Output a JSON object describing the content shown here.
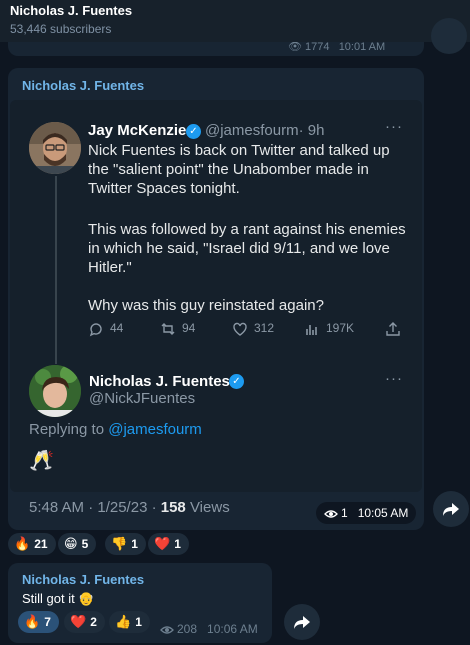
{
  "header": {
    "title": "Nicholas J. Fuentes",
    "subscribers": "53,446 subscribers"
  },
  "previous_message": {
    "views": "1774",
    "time": "10:01 AM"
  },
  "main_post": {
    "author": "Nicholas J. Fuentes",
    "tweet": {
      "author_name": "Jay McKenzie",
      "author_handle": "@jamesfourm",
      "age": "· 9h",
      "text_p1": "Nick Fuentes is back on Twitter and talked up the \"salient point\" the Unabomber made in Twitter Spaces tonight.",
      "text_p2": "This was followed by a rant against his enemies in which he said, \"Israel did 9/11, and we love Hitler.\"",
      "text_p3": "Why was this guy reinstated again?",
      "replies": "44",
      "retweets": "94",
      "likes": "312",
      "views": "197K"
    },
    "reply": {
      "author_name": "Nicholas J. Fuentes",
      "author_handle": "@NickJFuentes",
      "replying_prefix": "Replying to",
      "replying_to": "@jamesfourm",
      "emoji": "🥂",
      "timestamp": "5:48 AM · 1/25/23 ·",
      "views_count": "158",
      "views_label": "Views"
    },
    "views": "1",
    "time": "10:05 AM",
    "reactions": [
      {
        "emoji": "🔥",
        "count": "21"
      },
      {
        "emoji": "😁",
        "count": "5"
      },
      {
        "emoji": "👎",
        "count": "1"
      },
      {
        "emoji": "❤️",
        "count": "1"
      }
    ]
  },
  "second_post": {
    "author": "Nicholas J. Fuentes",
    "text": "Still got it",
    "text_emoji": "👴",
    "reactions": [
      {
        "emoji": "🔥",
        "count": "7"
      },
      {
        "emoji": "❤️",
        "count": "2"
      },
      {
        "emoji": "👍",
        "count": "1"
      }
    ],
    "views": "208",
    "time": "10:06 AM"
  },
  "colors": {
    "background": "#0e1621",
    "bubble": "#182533",
    "accent": "#71b5e8",
    "twitter_blue": "#1d9bf0"
  }
}
